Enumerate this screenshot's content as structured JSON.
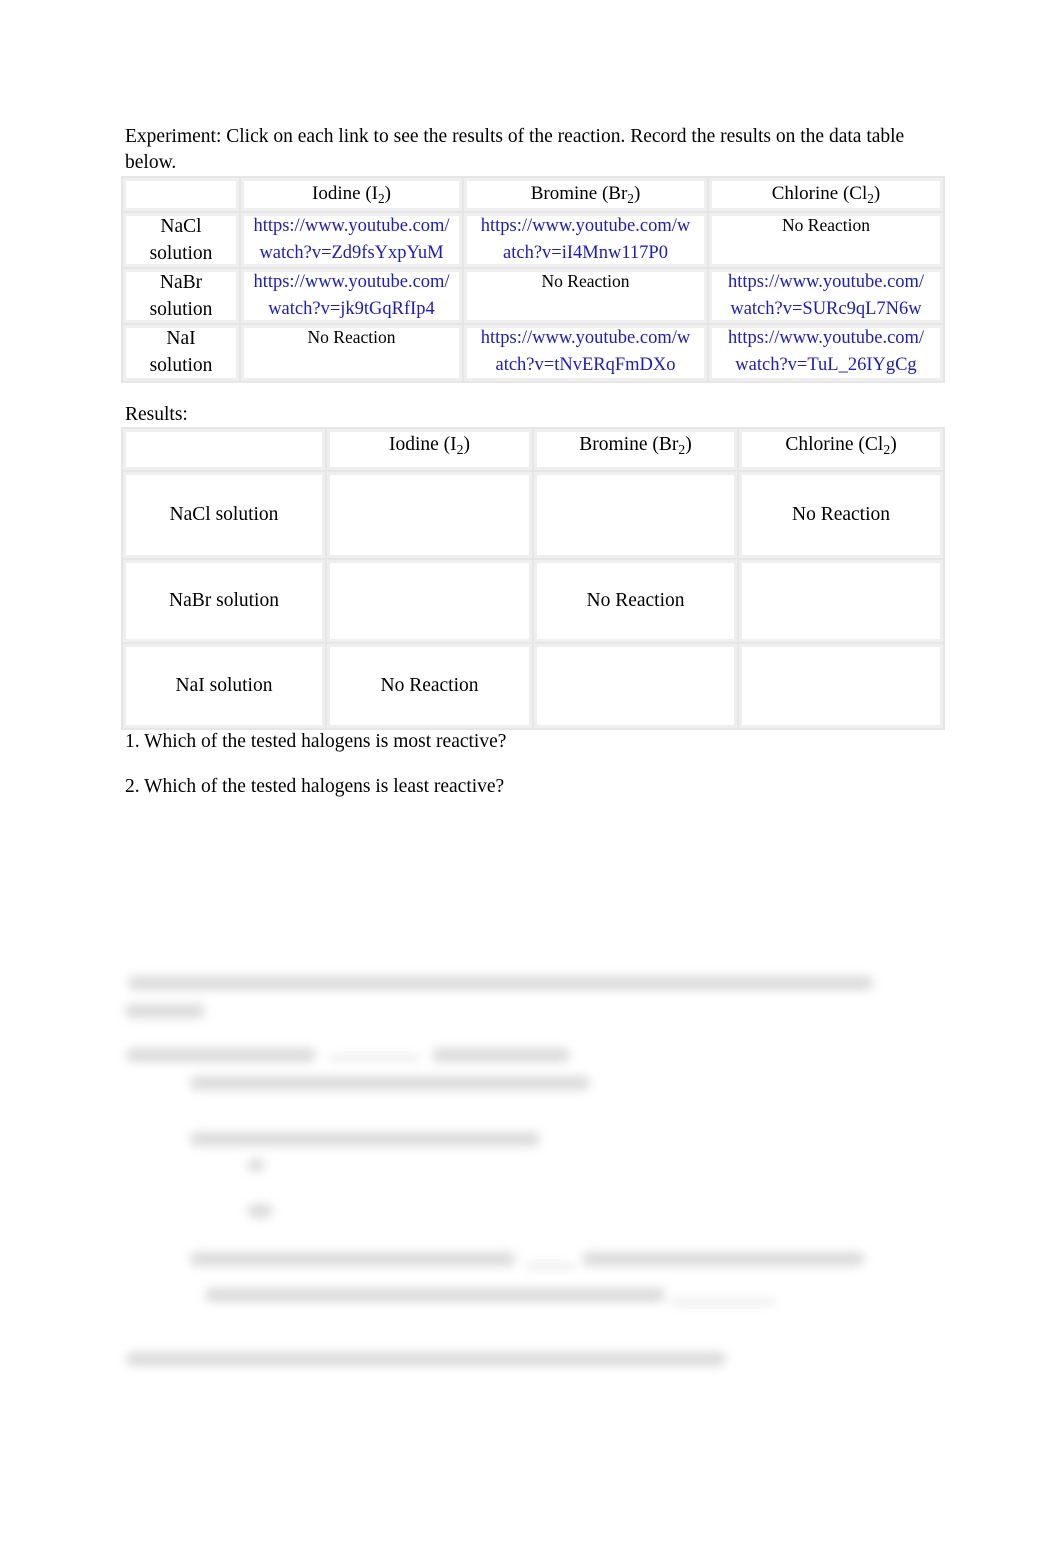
{
  "intro": {
    "text": "Experiment: Click on each link to see the results of the reaction. Record the results on the data table below."
  },
  "experiment_table": {
    "headers": [
      {
        "label": "",
        "base": "",
        "sub": "",
        "close": ""
      },
      {
        "label": "Iodine (I2)",
        "base": "Iodine (I",
        "sub": "2",
        "close": ")"
      },
      {
        "label": "Bromine (Br2)",
        "base": "Bromine (Br",
        "sub": "2",
        "close": ")"
      },
      {
        "label": "Chlorine (Cl2)",
        "base": "Chlorine (Cl",
        "sub": "2",
        "close": ")"
      }
    ],
    "rows": [
      {
        "label_line1": "NaCl",
        "label_line2": "solution",
        "cells": [
          {
            "type": "link",
            "line1": "https://www.youtube.com/",
            "line2": "watch?v=Zd9fsYxpYuM"
          },
          {
            "type": "link",
            "line1": "https://www.youtube.com/w",
            "line2": "atch?v=iI4Mnw117P0"
          },
          {
            "type": "text",
            "line1": "No Reaction",
            "line2": ""
          }
        ]
      },
      {
        "label_line1": "NaBr",
        "label_line2": "solution",
        "cells": [
          {
            "type": "link",
            "line1": "https://www.youtube.com/",
            "line2": "watch?v=jk9tGqRfIp4"
          },
          {
            "type": "text",
            "line1": "No Reaction",
            "line2": ""
          },
          {
            "type": "link",
            "line1": "https://www.youtube.com/",
            "line2": "watch?v=SURc9qL7N6w"
          }
        ]
      },
      {
        "label_line1": "NaI",
        "label_line2": "solution",
        "cells": [
          {
            "type": "text",
            "line1": "No Reaction",
            "line2": ""
          },
          {
            "type": "link",
            "line1": "https://www.youtube.com/w",
            "line2": "atch?v=tNvERqFmDXo"
          },
          {
            "type": "link",
            "line1": "https://www.youtube.com/",
            "line2": "watch?v=TuL_26IYgCg"
          }
        ]
      }
    ]
  },
  "results": {
    "label": "Results:",
    "headers": [
      {
        "base": "",
        "sub": "",
        "close": ""
      },
      {
        "base": "Iodine (I",
        "sub": "2",
        "close": ")"
      },
      {
        "base": "Bromine (Br",
        "sub": "2",
        "close": ")"
      },
      {
        "base": "Chlorine (Cl",
        "sub": "2",
        "close": ")"
      }
    ],
    "rows": [
      {
        "label": "NaCl solution",
        "cells": [
          "",
          "",
          "No Reaction"
        ]
      },
      {
        "label": "NaBr solution",
        "cells": [
          "",
          "No Reaction",
          ""
        ]
      },
      {
        "label": "NaI solution",
        "cells": [
          "No Reaction",
          "",
          ""
        ]
      }
    ]
  },
  "questions": [
    "1. Which of the tested halogens is most reactive?",
    "2. Which of the tested halogens is least reactive?"
  ],
  "colors": {
    "link": "#1a1ad6",
    "text": "#000000",
    "grid": "#e6e6e6"
  }
}
